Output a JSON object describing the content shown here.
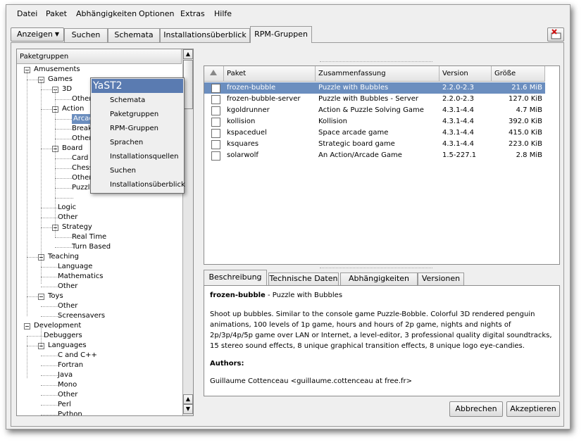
{
  "menubar": [
    "Datei",
    "Paket",
    "Abhängigkeiten",
    "Optionen",
    "Extras",
    "Hilfe"
  ],
  "view_button": "Anzeigen",
  "tabs": [
    "Suchen",
    "Schemata",
    "Installationsüberblick",
    "RPM-Gruppen"
  ],
  "tree_header": "Paketgruppen",
  "tree": [
    {
      "label": "Amusements",
      "indent": 0,
      "toggle": true
    },
    {
      "label": "Games",
      "indent": 1,
      "toggle": true
    },
    {
      "label": "3D",
      "indent": 2,
      "toggle": true
    },
    {
      "label": "Other",
      "indent": 3,
      "toggle": false
    },
    {
      "label": "Action",
      "indent": 2,
      "toggle": true
    },
    {
      "label": "Arcade",
      "indent": 3,
      "toggle": false,
      "selected": true
    },
    {
      "label": "Breakout",
      "indent": 3,
      "toggle": false
    },
    {
      "label": "Other",
      "indent": 3,
      "toggle": false
    },
    {
      "label": "Board",
      "indent": 2,
      "toggle": true
    },
    {
      "label": "Card",
      "indent": 3,
      "toggle": false
    },
    {
      "label": "Chess",
      "indent": 3,
      "toggle": false
    },
    {
      "label": "Other",
      "indent": 3,
      "toggle": false
    },
    {
      "label": "Puzzle",
      "indent": 3,
      "toggle": false
    },
    {
      "label": "",
      "indent": 3,
      "toggle": false
    },
    {
      "label": "Logic",
      "indent": 2,
      "toggle": false
    },
    {
      "label": "Other",
      "indent": 2,
      "toggle": false
    },
    {
      "label": "Strategy",
      "indent": 2,
      "toggle": true
    },
    {
      "label": "Real Time",
      "indent": 3,
      "toggle": false
    },
    {
      "label": "Turn Based",
      "indent": 3,
      "toggle": false
    },
    {
      "label": "Teaching",
      "indent": 1,
      "toggle": true
    },
    {
      "label": "Language",
      "indent": 2,
      "toggle": false
    },
    {
      "label": "Mathematics",
      "indent": 2,
      "toggle": false
    },
    {
      "label": "Other",
      "indent": 2,
      "toggle": false
    },
    {
      "label": "Toys",
      "indent": 1,
      "toggle": true
    },
    {
      "label": "Other",
      "indent": 2,
      "toggle": false
    },
    {
      "label": "Screensavers",
      "indent": 2,
      "toggle": false
    },
    {
      "label": "Development",
      "indent": 0,
      "toggle": true
    },
    {
      "label": "Debuggers",
      "indent": 1,
      "toggle": false
    },
    {
      "label": "Languages",
      "indent": 1,
      "toggle": true
    },
    {
      "label": "C and C++",
      "indent": 2,
      "toggle": false
    },
    {
      "label": "Fortran",
      "indent": 2,
      "toggle": false
    },
    {
      "label": "Java",
      "indent": 2,
      "toggle": false
    },
    {
      "label": "Mono",
      "indent": 2,
      "toggle": false
    },
    {
      "label": "Other",
      "indent": 2,
      "toggle": false
    },
    {
      "label": "Perl",
      "indent": 2,
      "toggle": false
    },
    {
      "label": "Python",
      "indent": 2,
      "toggle": false
    }
  ],
  "popup": {
    "title": "YaST2",
    "items": [
      "Schemata",
      "Paketgruppen",
      "RPM-Gruppen",
      "Sprachen",
      "Installationsquellen",
      "Suchen",
      "Installationsüberblick"
    ]
  },
  "table": {
    "columns": [
      "Paket",
      "Zusammenfassung",
      "Version",
      "Größe"
    ],
    "rows": [
      {
        "paket": "frozen-bubble",
        "summary": "Puzzle with Bubbles",
        "version": "2.2.0-2.3",
        "size": "21.6 MiB",
        "selected": true
      },
      {
        "paket": "frozen-bubble-server",
        "summary": "Puzzle with Bubbles - Server",
        "version": "2.2.0-2.3",
        "size": "127.0 KiB"
      },
      {
        "paket": "kgoldrunner",
        "summary": "Action & Puzzle Solving Game",
        "version": "4.3.1-4.4",
        "size": "4.7 MiB"
      },
      {
        "paket": "kollision",
        "summary": "Kollision",
        "version": "4.3.1-4.4",
        "size": "392.0 KiB"
      },
      {
        "paket": "kspaceduel",
        "summary": "Space arcade game",
        "version": "4.3.1-4.4",
        "size": "415.0 KiB"
      },
      {
        "paket": "ksquares",
        "summary": "Strategic board game",
        "version": "4.3.1-4.4",
        "size": "223.0 KiB"
      },
      {
        "paket": "solarwolf",
        "summary": "An Action/Arcade Game",
        "version": "1.5-227.1",
        "size": "2.8 MiB"
      }
    ]
  },
  "detail_tabs": [
    "Beschreibung",
    "Technische Daten",
    "Abhängigkeiten",
    "Versionen"
  ],
  "detail": {
    "name": "frozen-bubble",
    "summary_suffix": " - Puzzle with Bubbles",
    "description": "Shoot up bubbles. Similar to the console game Puzzle-Bobble. Colorful 3D rendered penguin animations, 100 levels of 1p game, hours and hours of 2p game, nights and nights of 2p/3p/4p/5p game over LAN or Internet, a level-editor, 3 professional quality digital soundtracks, 15 stereo sound effects, 8 unique graphical transition effects, 8 unique logo eye-candies.",
    "authors_label": "Authors:",
    "author": "Guillaume Cottenceau <guillaume.cottenceau at free.fr>"
  },
  "buttons": {
    "cancel": "Abbrechen",
    "accept": "Akzeptieren"
  }
}
